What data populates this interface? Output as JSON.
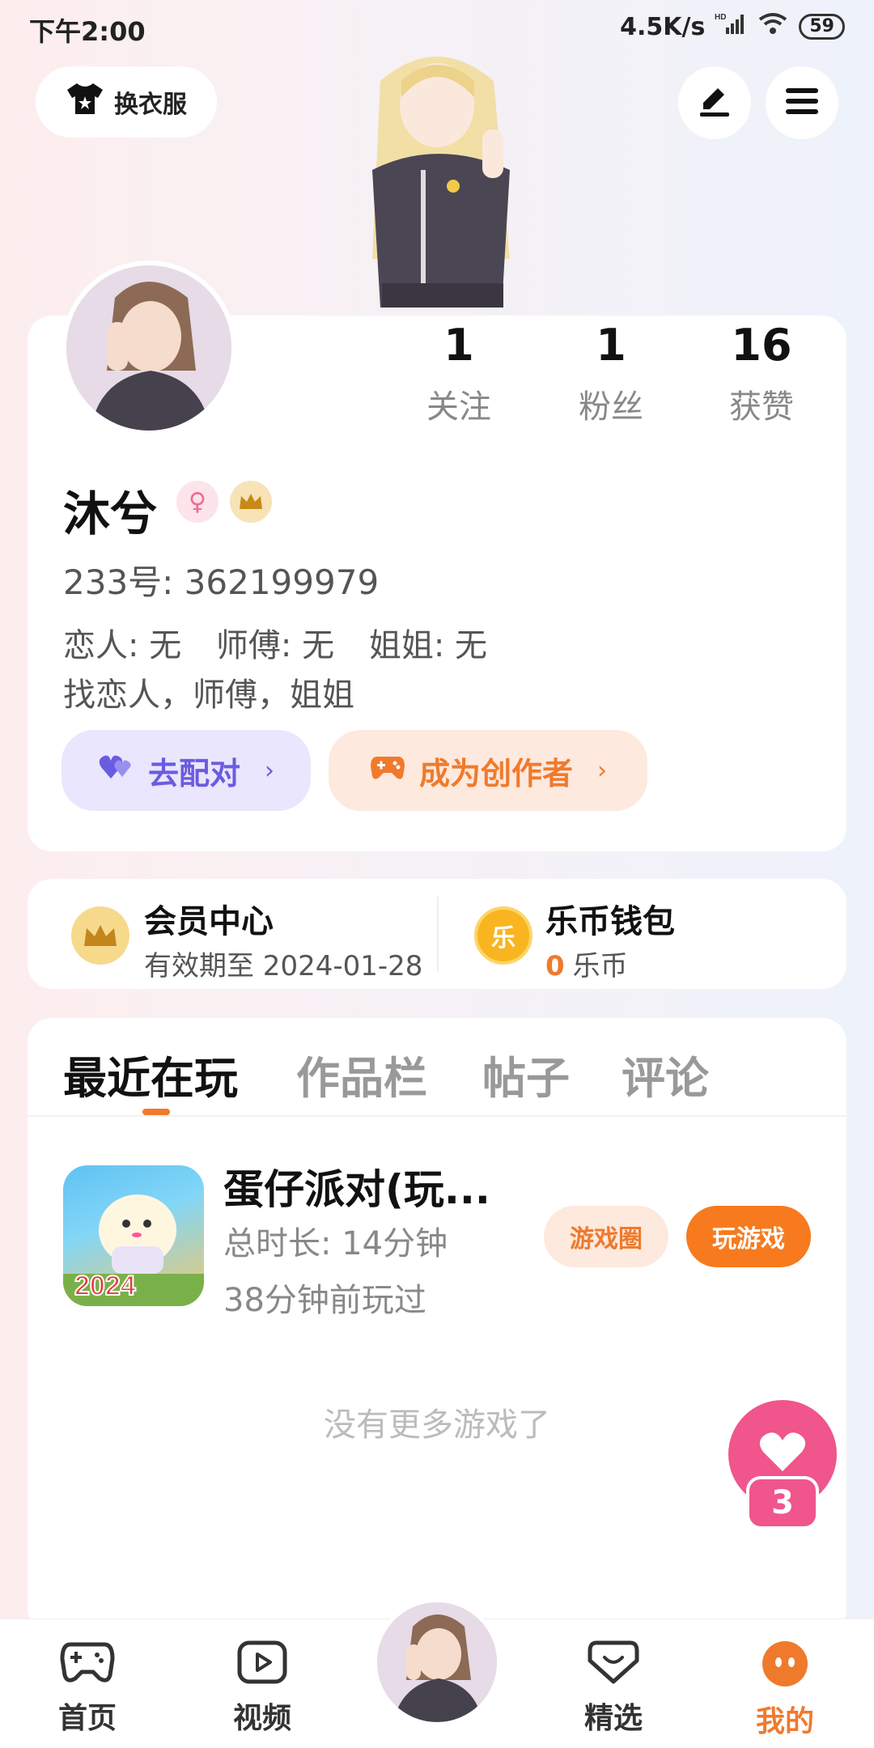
{
  "status_bar": {
    "time": "下午2:00",
    "network_speed": "4.5K/s",
    "signal_label": "HD",
    "battery": "59"
  },
  "top_bar": {
    "outfit_label": "换衣服",
    "edit_icon": "pen-icon",
    "menu_icon": "hamburger-icon"
  },
  "profile": {
    "name": "沐兮",
    "gender_icon": "female-icon",
    "vip_icon": "crown-icon",
    "uid": "233号: 362199979",
    "relations": [
      "恋人: 无",
      "师傅: 无",
      "姐姐: 无"
    ],
    "find_line": "找恋人，师傅，姐姐",
    "stats": [
      {
        "value": "1",
        "label": "关注"
      },
      {
        "value": "1",
        "label": "粉丝"
      },
      {
        "value": "16",
        "label": "获赞"
      }
    ],
    "match_button": "去配对",
    "creator_button": "成为创作者"
  },
  "member": {
    "title": "会员中心",
    "subtitle": "有效期至 2024-01-28"
  },
  "wallet": {
    "title": "乐币钱包",
    "amount": "0",
    "unit": "乐币",
    "coin_glyph": "乐"
  },
  "tabs": [
    "最近在玩",
    "作品栏",
    "帖子",
    "评论"
  ],
  "game": {
    "title": "蛋仔派对(玩...",
    "duration": "总时长: 14分钟",
    "last_played": "38分钟前玩过",
    "icon_text": "2024",
    "circle_button": "游戏圈",
    "play_button": "玩游戏"
  },
  "empty_text": "没有更多游戏了",
  "floating": {
    "count": "3"
  },
  "bottom_nav": [
    {
      "label": "首页",
      "icon": "gamepad-icon"
    },
    {
      "label": "视频",
      "icon": "video-icon"
    },
    {
      "label": "",
      "icon": "avatar"
    },
    {
      "label": "精选",
      "icon": "heart-badge-icon"
    },
    {
      "label": "我的",
      "icon": "me-icon"
    }
  ],
  "colors": {
    "accent": "#f07a2c",
    "match_purple": "#6a5ce0",
    "pink": "#f0558b"
  }
}
